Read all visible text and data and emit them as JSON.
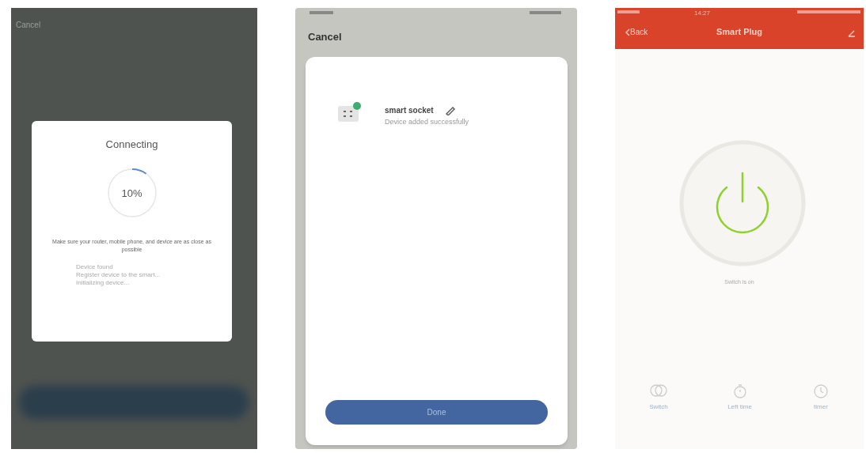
{
  "screens": [
    {
      "kind": "connecting",
      "cancel": "Cancel",
      "title": "Connecting",
      "progress": {
        "level": 0.1,
        "reading": "10%"
      },
      "hint": "Make sure your router, mobile phone, and device are as close as possible",
      "steps": [
        "Device found",
        "Register device to the smart...",
        "Initializing device..."
      ]
    },
    {
      "kind": "added",
      "cancel": "Cancel",
      "device": {
        "name": "smart socket",
        "status": "Device added successfully"
      },
      "button": "Done"
    },
    {
      "kind": "control",
      "status_bar": {
        "time": "14:27"
      },
      "back": "Back",
      "title": "Smart Plug",
      "power": {
        "on": true
      },
      "state_text": "Switch is on",
      "actions": [
        {
          "kind": "switch",
          "label": "Switch"
        },
        {
          "kind": "stopwatch",
          "label": "Left time"
        },
        {
          "kind": "clock",
          "label": "timer"
        }
      ]
    }
  ]
}
